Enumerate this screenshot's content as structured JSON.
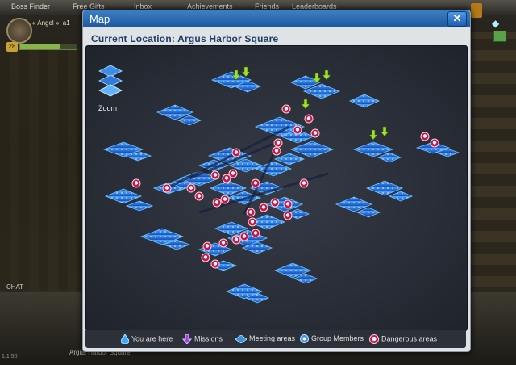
{
  "topbar": {
    "tabs": [
      "Boss Finder",
      "Free Gifts",
      "Inbox",
      "Achievements",
      "Friends",
      "Leaderboards"
    ]
  },
  "player": {
    "name": "« Angel », a1",
    "level": "28",
    "health_fraction": 0.72
  },
  "chat_label": "CHAT",
  "footer": {
    "location": "Argus Harbor Square",
    "version": "1.1.50"
  },
  "dialog": {
    "title": "Map",
    "close_label": "✕",
    "current_location": "Current Location: Argus Harbor Square",
    "zoom_label": "Zoom"
  },
  "legend": {
    "here": "You are here",
    "missions": "Missions",
    "meeting": "Meeting areas",
    "group": "Group Members",
    "danger": "Dangerous areas"
  },
  "colors": {
    "header": "#2a6bb5",
    "district": "#2f72d8",
    "district_glow": "#6fc4ff",
    "danger": "#c4174a",
    "mission": "#9ee22a"
  },
  "icons": {
    "close": "close-icon",
    "zoom": "zoom-layers-icon",
    "here": "water-drop-icon",
    "mission": "mission-arrow-icon",
    "meeting": "meeting-area-icon",
    "group": "group-member-icon",
    "danger": "danger-skull-icon",
    "gem": "gem-icon"
  }
}
